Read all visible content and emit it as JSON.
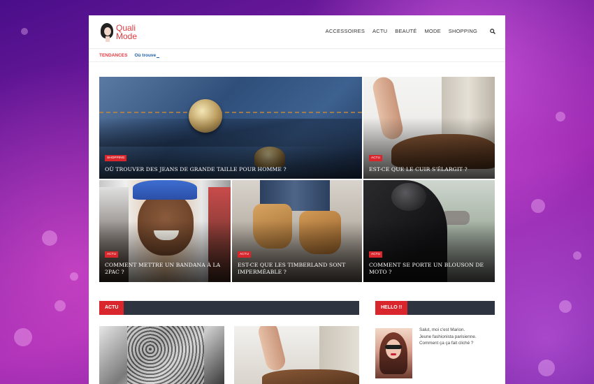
{
  "site": {
    "logo_line1": "Quali",
    "logo_line2": "Mode"
  },
  "nav": {
    "items": [
      "ACCESSOIRES",
      "ACTU",
      "BEAUTÉ",
      "MODE",
      "SHOPPING"
    ]
  },
  "trending": {
    "label": "TENDANCES",
    "text": "Où trouve"
  },
  "featured": [
    {
      "badge": "SHOPPING",
      "title": "OÙ TROUVER DES JEANS DE GRANDE TAILLE POUR HOMME ?"
    },
    {
      "badge": "ACTU",
      "title": "EST-CE QUE LE CUIR S'ÉLARGIT ?"
    },
    {
      "badge": "ACTU",
      "title": "COMMENT METTRE UN BANDANA À LA 2PAC ?"
    },
    {
      "badge": "ACTU",
      "title": "EST-CE QUE LES TIMBERLAND SONT IMPERMÉABLE ?"
    },
    {
      "badge": "ACTU",
      "title": "COMMENT SE PORTE UN BLOUSON DE MOTO ?"
    }
  ],
  "sections": {
    "actu_label": "ACTU",
    "hello_label": "HELLO !!"
  },
  "about": {
    "line1": "Salut, moi c'est Marion.",
    "line2": "Jeune fashionista parisienne.",
    "line3": "Comment ça ça fait cliché ?"
  },
  "colors": {
    "accent": "#d9262c",
    "dark_bar": "#2f3540",
    "link": "#1d5fa8"
  }
}
